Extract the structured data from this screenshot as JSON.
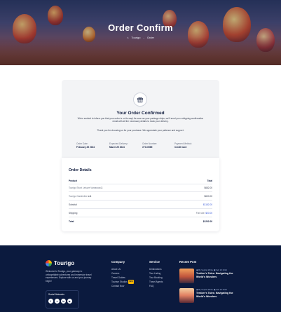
{
  "hero": {
    "title": "Order Confirm",
    "breadcrumb": [
      "Tourigo",
      "Order"
    ]
  },
  "confirmation": {
    "title": "Your Order Confirmed",
    "text": "We're excited to inform you that your order is on its way! As soon as your package ships, we'll send you a shipping confirmation email with all the necessary details to track your delivery.",
    "thanks": "Thank you for choosing us for your purchase. We appreciate your patience and support.",
    "meta": [
      {
        "label": "Order Date:",
        "value": "February 25 2024"
      },
      {
        "label": "Expected Delivery:",
        "value": "March 25 2024"
      },
      {
        "label": "Order Number:",
        "value": "#TG-0985"
      },
      {
        "label": "Payment Method:",
        "value": "Credit Card"
      }
    ]
  },
  "details": {
    "title": "Order Details",
    "head": {
      "product": "Product",
      "total": "Total"
    },
    "items": [
      {
        "name": "Tourigo Short Leisure Vamana",
        "qty": "x 1",
        "total": "$682.00"
      },
      {
        "name": "Tourigo Gardenline",
        "qty": "x 1",
        "total": "$600.00"
      }
    ],
    "subtotal": {
      "label": "Subtotal",
      "value": "$1182.00"
    },
    "shipping": {
      "label": "Shipping",
      "prefix": "Flat rate:",
      "value": "$20.00"
    },
    "total": {
      "label": "Total",
      "value": "$1202.00"
    }
  },
  "footer": {
    "brand": "Tourigo",
    "about": "Welcome to Tourigo, your gateway to unforgettable adventures and immersive travel experiences. Explore with us and your journey begin!",
    "social_title": "Social Networks",
    "social": [
      "f",
      "x",
      "in",
      "yt"
    ],
    "company": {
      "title": "Company",
      "links": [
        "About Us",
        "Careers",
        "Travel Guides",
        "Tourism Studios",
        "Contact Now"
      ],
      "badge": "NEW"
    },
    "service": {
      "title": "Service",
      "links": [
        "Destinations",
        "Tour Listing",
        "Tour Booking",
        "Travel Agents",
        "FAQ"
      ]
    },
    "recent": {
      "title": "Recent Post",
      "posts": [
        {
          "author": "By Sophia White",
          "date": "Feb 26 2024",
          "title": "Trekker's Tales: Navigating the World's Wonders"
        },
        {
          "author": "By Sophia White",
          "date": "Feb 26 2024",
          "title": "Trekker's Tales: Navigating the World's Wonders"
        }
      ]
    }
  },
  "colors": {
    "navy": "#0b1a3e",
    "accent": "#3a5bd9",
    "badge": "#f5b400"
  }
}
